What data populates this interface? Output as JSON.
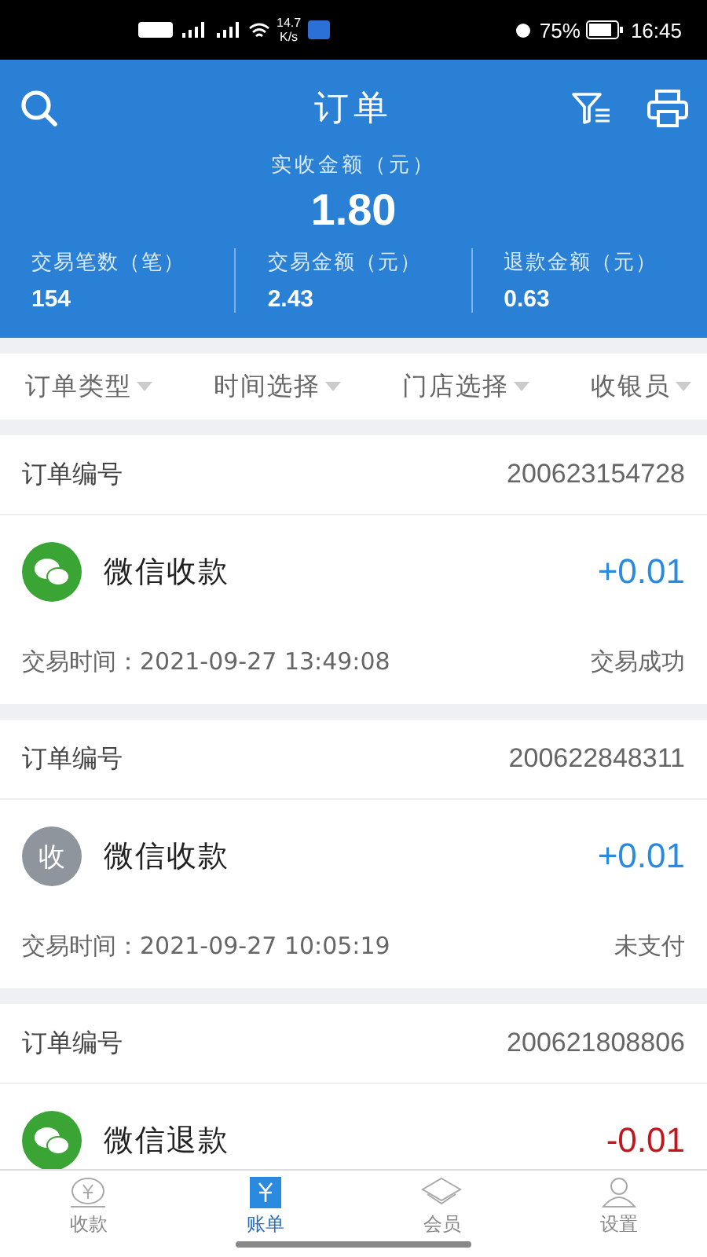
{
  "status_bar": {
    "speed": "14.7",
    "speed_unit": "K/s",
    "battery": "75%",
    "time": "16:45"
  },
  "header": {
    "title": "订单",
    "summary_label": "实收金额（元）",
    "summary_value": "1.80",
    "stats": [
      {
        "label": "交易笔数（笔）",
        "value": "154"
      },
      {
        "label": "交易金额（元）",
        "value": "2.43"
      },
      {
        "label": "退款金额（元）",
        "value": "0.63"
      }
    ]
  },
  "filters": [
    "订单类型",
    "时间选择",
    "门店选择",
    "收银员"
  ],
  "orders": [
    {
      "number_label": "订单编号",
      "number": "200623154728",
      "icon": {
        "kind": "wechat"
      },
      "title": "微信收款",
      "kind": "payment",
      "amount": "+0.01",
      "time": "交易时间：2021-09-27 13:49:08",
      "status": "交易成功"
    },
    {
      "number_label": "订单编号",
      "number": "200622848311",
      "icon": {
        "kind": "text",
        "text": "收"
      },
      "title": "微信收款",
      "kind": "payment",
      "amount": "+0.01",
      "time": "交易时间：2021-09-27 10:05:19",
      "status": "未支付"
    },
    {
      "number_label": "订单编号",
      "number": "200621808806",
      "icon": {
        "kind": "wechat"
      },
      "title": "微信退款",
      "kind": "refund",
      "amount": "-0.01"
    }
  ],
  "nav": [
    {
      "label": "收款",
      "kind": "yen",
      "selected": false
    },
    {
      "label": "账单",
      "kind": "bill",
      "selected": true
    },
    {
      "label": "会员",
      "kind": "diamond",
      "selected": false
    },
    {
      "label": "设置",
      "kind": "person",
      "selected": false
    }
  ]
}
